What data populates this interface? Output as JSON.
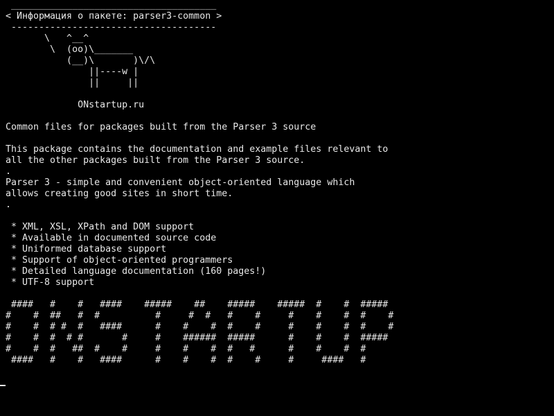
{
  "terminal": {
    "lines": [
      " _____________________________________",
      "< Информация о пакете: parser3-common >",
      " -------------------------------------",
      "       \\   ^__^",
      "        \\  (oo)\\_______",
      "           (__)\\       )\\/\\",
      "               ||----w |",
      "               ||     ||",
      "",
      "             ONstartup.ru",
      "",
      "Common files for packages built from the Parser 3 source",
      "",
      "This package contains the documentation and example files relevant to",
      "all the other packages built from the Parser 3 source.",
      ".",
      "Parser 3 - simple and convenient object-oriented language which",
      "allows creating good sites in short time.",
      ".",
      "",
      " * XML, XSL, XPath and DOM support",
      " * Available in documented source code",
      " * Uniformed database support",
      " * Support of object-oriented programmers",
      " * Detailed language documentation (160 pages!)",
      " * UTF-8 support",
      "",
      " ####   #    #   ####    #####    ##    #####    #####  #    #  #####",
      "#    #  ##   #  #          #     #  #   #    #     #    #    #  #    #",
      "#    #  # #  #   ####      #    #    #  #    #     #    #    #  #    #",
      "#    #  #  # #       #     #    ######  #####      #    #    #  #####",
      "#    #  #   ##  #    #     #    #    #  #   #      #    #    #  #",
      " ####   #    #   ####      #    #    #  #    #     #     ####   #"
    ]
  }
}
